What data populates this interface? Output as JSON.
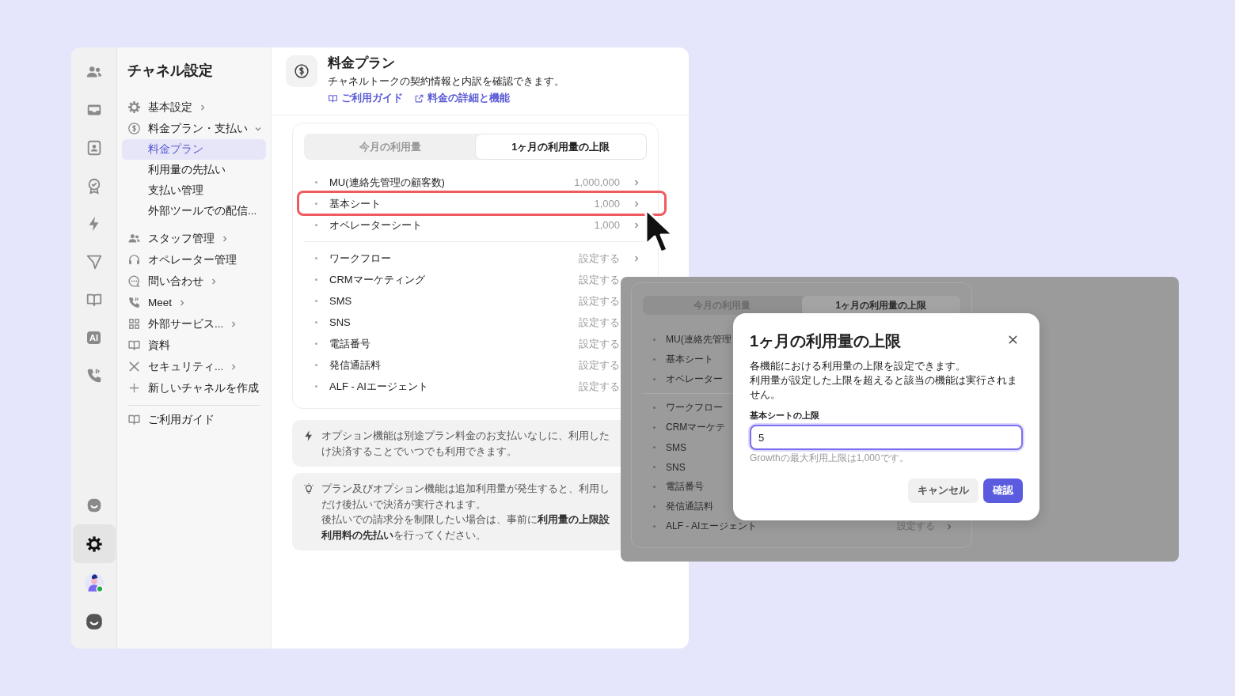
{
  "rail": {
    "top": [
      {
        "kind": "people"
      },
      {
        "kind": "inbox"
      },
      {
        "kind": "contact"
      },
      {
        "kind": "badge"
      },
      {
        "kind": "bolt"
      },
      {
        "kind": "send"
      },
      {
        "kind": "book"
      },
      {
        "kind": "ai",
        "label": "AI"
      },
      {
        "kind": "phone"
      }
    ],
    "bottom": [
      {
        "kind": "chat-muted",
        "selected": false
      },
      {
        "kind": "gear",
        "selected": true
      },
      {
        "kind": "avatar",
        "selected": false
      },
      {
        "kind": "chat",
        "selected": false
      }
    ]
  },
  "sidebar": {
    "title": "チャネル設定",
    "items": [
      {
        "kind": "gear",
        "label": "基本設定",
        "submenu": true
      },
      {
        "kind": "dollar",
        "label": "料金プラン・支払い",
        "submenu": true,
        "expanded": true,
        "children": [
          {
            "label": "料金プラン",
            "selected": true
          },
          {
            "label": "利用量の先払い",
            "selected": false
          },
          {
            "label": "支払い管理",
            "selected": false
          },
          {
            "label": "外部ツールでの配信...",
            "selected": false
          }
        ]
      },
      {
        "kind": "people",
        "label": "スタッフ管理",
        "submenu": true
      },
      {
        "kind": "headset",
        "label": "オペレーター管理",
        "submenu": false
      },
      {
        "kind": "speech",
        "label": "問い合わせ",
        "submenu": true
      },
      {
        "kind": "phone",
        "label": "Meet",
        "submenu": true
      },
      {
        "kind": "grid",
        "label": "外部サービス...",
        "submenu": true
      },
      {
        "kind": "book",
        "label": "資料",
        "submenu": false
      },
      {
        "kind": "tools",
        "label": "セキュリティ...",
        "submenu": true
      },
      {
        "kind": "plus",
        "label": "新しいチャネルを作成"
      }
    ],
    "footer": {
      "kind": "book",
      "label": "ご利用ガイド"
    }
  },
  "header": {
    "title": "料金プラン",
    "description": "チャネルトークの契約情報と内訳を確認できます。",
    "links": [
      {
        "kind": "book",
        "label": "ご利用ガイド"
      },
      {
        "kind": "external",
        "label": "料金の詳細と機能"
      }
    ]
  },
  "card": {
    "tabs": [
      {
        "label": "今月の利用量",
        "selected": false
      },
      {
        "label": "1ヶ月の利用量の上限",
        "selected": true
      }
    ],
    "groups": [
      [
        {
          "name": "MU(連絡先管理の顧客数)",
          "value": "1,000,000",
          "chevron": true,
          "highlighted": false
        },
        {
          "name": "基本シート",
          "value": "1,000",
          "chevron": true,
          "highlighted": true
        },
        {
          "name": "オペレーターシート",
          "value": "1,000",
          "chevron": true,
          "highlighted": false
        }
      ],
      [
        {
          "name": "ワークフロー",
          "value": "設定する",
          "chevron": true,
          "highlighted": false
        },
        {
          "name": "CRMマーケティング",
          "value": "設定する",
          "highlighted": false
        },
        {
          "name": "SMS",
          "value": "設定する",
          "highlighted": false
        },
        {
          "name": "SNS",
          "value": "設定する",
          "highlighted": false
        },
        {
          "name": "電話番号",
          "value": "設定する",
          "highlighted": false
        },
        {
          "name": "発信通話料",
          "value": "設定する",
          "highlighted": false
        },
        {
          "name": "ALF - AIエージェント",
          "value": "設定する",
          "highlighted": false
        }
      ]
    ]
  },
  "notes": [
    {
      "kind": "bolt",
      "lines": [
        "オプション機能は別途プラン料金のお支払いなしに、利用した",
        "け決済することでいつでも利用できます。"
      ]
    },
    {
      "kind": "bulb",
      "lines": [
        "プラン及びオプション機能は追加利用量が発生すると、利用し",
        "だけ後払いで決済が実行されます。",
        "後払いでの請求分を制限したい場合は、事前に**利用量の上限設**",
        "**利用料の先払い**を行ってください。"
      ]
    }
  ],
  "overlay": {
    "tabs": [
      {
        "label": "今月の利用量",
        "selected": false
      },
      {
        "label": "1ヶ月の利用量の上限",
        "selected": true
      }
    ],
    "groups": [
      [
        {
          "name": "MU(連絡先管理"
        },
        {
          "name": "基本シート"
        },
        {
          "name": "オペレーター"
        }
      ],
      [
        {
          "name": "ワークフロー"
        },
        {
          "name": "CRMマーケテ"
        },
        {
          "name": "SMS"
        },
        {
          "name": "SNS"
        },
        {
          "name": "電話番号"
        },
        {
          "name": "発信通話料"
        },
        {
          "name": "ALF - AIエージェント",
          "value": "設定する",
          "chevron": true
        }
      ]
    ],
    "dialog": {
      "title": "1ヶ月の利用量の上限",
      "description": [
        "各機能における利用量の上限を設定できます。",
        "利用量が設定した上限を超えると該当の機能は実行されません。"
      ],
      "field": {
        "label": "基本シートの上限",
        "value": "5",
        "hint": "Growthの最大利用上限は1,000です。"
      },
      "buttons": [
        {
          "kind": "secondary",
          "label": "キャンセル"
        },
        {
          "kind": "primary",
          "label": "確認"
        }
      ]
    }
  }
}
